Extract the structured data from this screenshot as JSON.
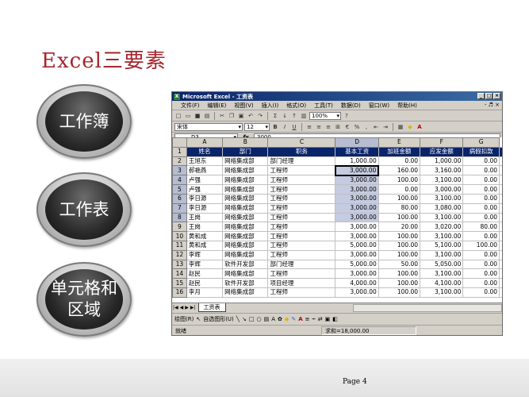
{
  "slide": {
    "title": "Excel三要素",
    "bubbles": [
      "工作簿",
      "工作表",
      "单元格和\n区域"
    ],
    "page": "Page 4"
  },
  "excel": {
    "window_title": "Microsoft Excel - 工资表",
    "logo": "X",
    "win_buttons": [
      "_",
      "□",
      "×"
    ],
    "mdi_buttons": "- ♬ ×",
    "menu": [
      "文件(F)",
      "编辑(E)",
      "视图(V)",
      "插入(I)",
      "格式(O)",
      "工具(T)",
      "数据(D)",
      "窗口(W)",
      "帮助(H)"
    ],
    "zoom": "100%",
    "font_name": "宋体",
    "font_size": "12",
    "toolbar_b": "B",
    "toolbar_i": "I",
    "toolbar_u": "U",
    "currency": "€",
    "percent": "%",
    "name_box": "D3",
    "fx_label": "fx",
    "formula": "3000",
    "columns": [
      "A",
      "B",
      "C",
      "D",
      "E",
      "F",
      "G"
    ],
    "rows": [
      {
        "n": "1",
        "cells": [
          "姓名",
          "部门",
          "职务",
          "基本工资",
          "加班金额",
          "应发金额",
          "病假扣款"
        ]
      },
      {
        "n": "2",
        "cells": [
          "王旭东",
          "网络集成部",
          "部门经理",
          "1,000.00",
          "0.00",
          "1,000.00",
          "0.00"
        ]
      },
      {
        "n": "3",
        "cells": [
          "郝艳燕",
          "网络集成部",
          "工程师",
          "3,000.00",
          "160.00",
          "3,160.00",
          "0.00"
        ]
      },
      {
        "n": "4",
        "cells": [
          "卢强",
          "网络集成部",
          "工程师",
          "3,000.00",
          "100.00",
          "3,100.00",
          "0.00"
        ]
      },
      {
        "n": "5",
        "cells": [
          "卢强",
          "网络集成部",
          "工程师",
          "3,000.00",
          "0.00",
          "3,000.00",
          "0.00"
        ]
      },
      {
        "n": "6",
        "cells": [
          "李日源",
          "网络集成部",
          "工程师",
          "3,000.00",
          "100.00",
          "3,100.00",
          "0.00"
        ]
      },
      {
        "n": "7",
        "cells": [
          "李日源",
          "网络集成部",
          "工程师",
          "3,000.00",
          "80.00",
          "3,080.00",
          "0.00"
        ]
      },
      {
        "n": "8",
        "cells": [
          "王岗",
          "网络集成部",
          "工程师",
          "3,000.00",
          "100.00",
          "3,100.00",
          "0.00"
        ]
      },
      {
        "n": "9",
        "cells": [
          "王岗",
          "网络集成部",
          "工程师",
          "3,000.00",
          "20.00",
          "3,020.00",
          "80.00"
        ]
      },
      {
        "n": "10",
        "cells": [
          "黄和成",
          "网络集成部",
          "工程师",
          "3,000.00",
          "100.00",
          "3,100.00",
          "0.00"
        ]
      },
      {
        "n": "11",
        "cells": [
          "黄和成",
          "网络集成部",
          "工程师",
          "5,000.00",
          "100.00",
          "5,100.00",
          "100.00"
        ]
      },
      {
        "n": "12",
        "cells": [
          "李辉",
          "网络集成部",
          "工程师",
          "3,000.00",
          "100.00",
          "3,100.00",
          "0.00"
        ]
      },
      {
        "n": "13",
        "cells": [
          "李辉",
          "软件开发部",
          "部门经理",
          "5,000.00",
          "50.00",
          "5,050.00",
          "0.00"
        ]
      },
      {
        "n": "14",
        "cells": [
          "赵民",
          "网络集成部",
          "工程师",
          "3,000.00",
          "100.00",
          "3,100.00",
          "0.00"
        ]
      },
      {
        "n": "15",
        "cells": [
          "赵民",
          "软件开发部",
          "项目经理",
          "4,000.00",
          "100.00",
          "4,100.00",
          "0.00"
        ]
      },
      {
        "n": "16",
        "cells": [
          "李月",
          "网络集成部",
          "工程师",
          "3,000.00",
          "100.00",
          "3,100.00",
          "0.00"
        ]
      }
    ],
    "sheet_tab": "工资表",
    "tab_nav": [
      "|◀",
      "◀",
      "▶",
      "▶|"
    ],
    "draw_label": "绘图(R)",
    "autoshape_label": "自选图形(U)",
    "status": "就绪",
    "sum": "求和=18,000.00"
  }
}
